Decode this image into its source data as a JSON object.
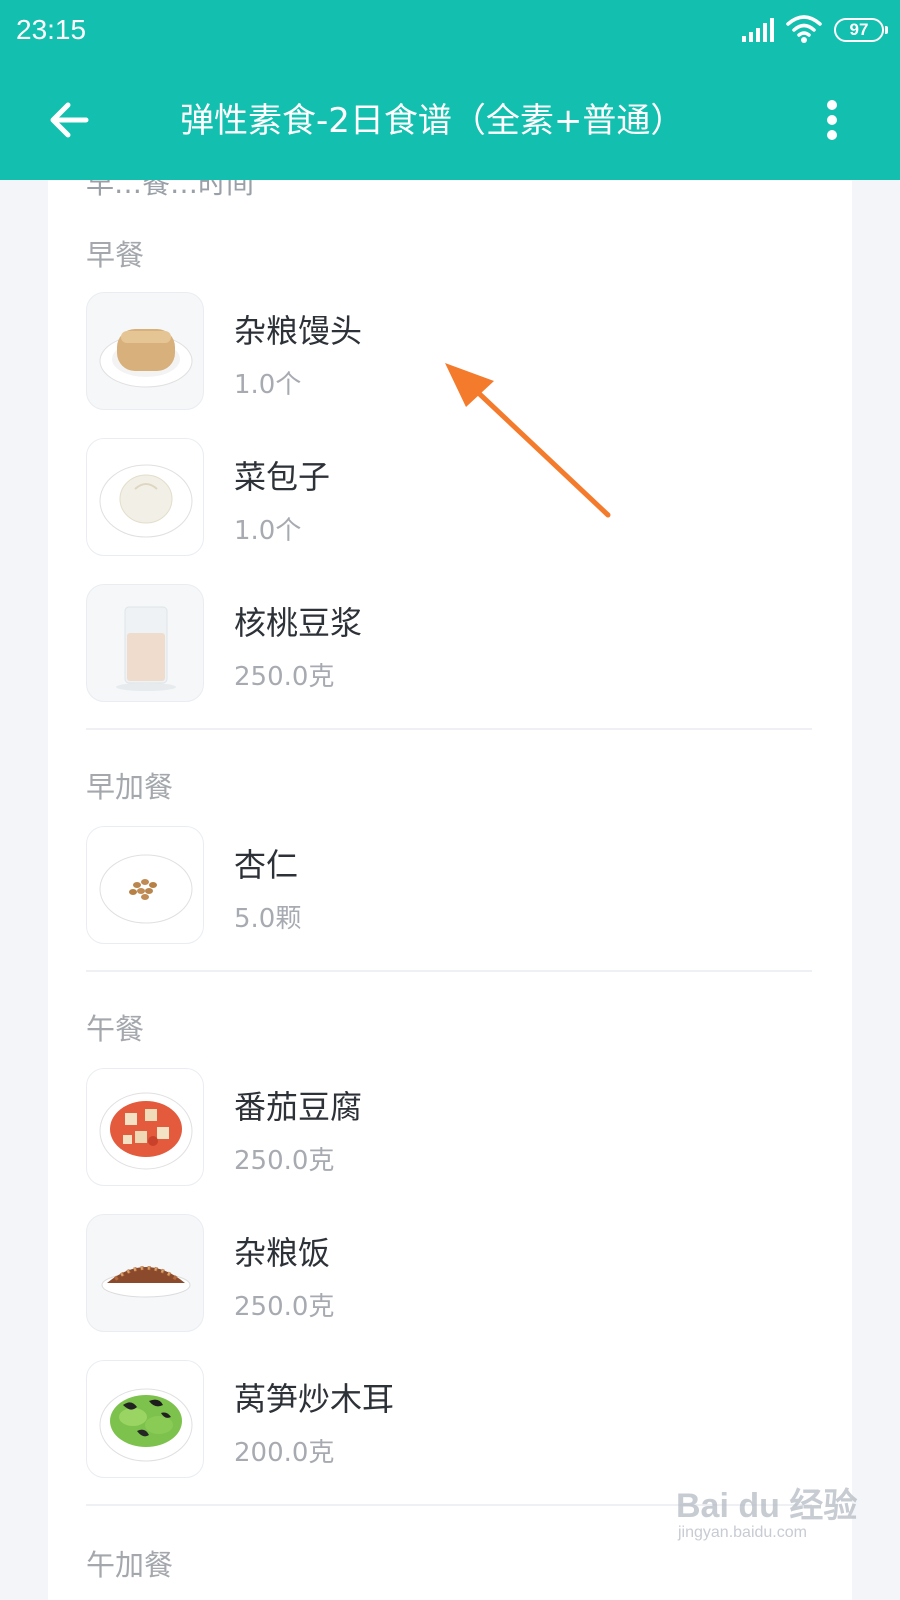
{
  "status_bar": {
    "time": "23:15",
    "battery": "97"
  },
  "header": {
    "title": "弹性素食-2日食谱（全素+普通）",
    "back_icon": "arrow-left-icon",
    "more_icon": "more-vertical-icon"
  },
  "colors": {
    "accent": "#13bfae",
    "annotation_arrow": "#f47a2c"
  },
  "peek_text": "早…餐…时间",
  "meals": [
    {
      "title": "早餐",
      "items": [
        {
          "name": "杂粮馒头",
          "qty": "1.0个",
          "image": "steamed-bun-plate"
        },
        {
          "name": "菜包子",
          "qty": "1.0个",
          "image": "vegetable-bun-plate"
        },
        {
          "name": "核桃豆浆",
          "qty": "250.0克",
          "image": "walnut-soymilk-glass"
        }
      ]
    },
    {
      "title": "早加餐",
      "items": [
        {
          "name": "杏仁",
          "qty": "5.0颗",
          "image": "almonds-plate"
        }
      ]
    },
    {
      "title": "午餐",
      "items": [
        {
          "name": "番茄豆腐",
          "qty": "250.0克",
          "image": "tomato-tofu-plate"
        },
        {
          "name": "杂粮饭",
          "qty": "250.0克",
          "image": "mixed-grain-rice-plate"
        },
        {
          "name": "莴笋炒木耳",
          "qty": "200.0克",
          "image": "lettuce-fungus-plate"
        }
      ]
    },
    {
      "title": "午加餐",
      "items": []
    }
  ],
  "watermark": {
    "main": "Bai du 经验",
    "sub": "jingyan.baidu.com"
  }
}
